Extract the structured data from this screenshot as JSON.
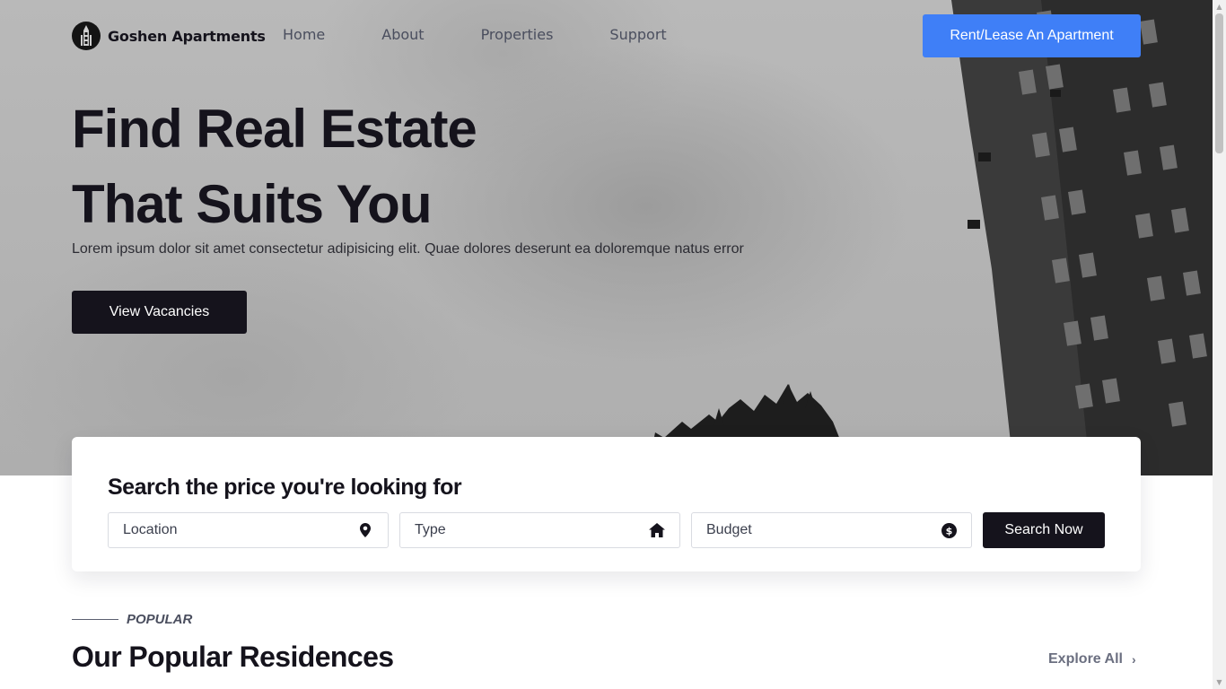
{
  "nav": {
    "brand_name": "Goshen Apartments",
    "links": [
      "Home",
      "About",
      "Properties",
      "Support"
    ],
    "cta_label": "Rent/Lease An Apartment",
    "cta_color": "#3f7ff7"
  },
  "hero": {
    "title_line1": "Find Real Estate",
    "title_line2": "That Suits You",
    "subtitle": "Lorem ipsum dolor sit amet consectetur adipisicing elit. Quae dolores deserunt ea doloremque natus error",
    "button_label": "View Vacancies"
  },
  "search": {
    "title": "Search the price you're looking for",
    "fields": [
      {
        "label": "Location",
        "icon": "map-pin-icon"
      },
      {
        "label": "Type",
        "icon": "home-icon"
      },
      {
        "label": "Budget",
        "icon": "dollar-circle-icon"
      }
    ],
    "button_label": "Search Now"
  },
  "popular": {
    "eyebrow": "POPULAR",
    "title": "Our Popular Residences",
    "explore_label": "Explore All",
    "explore_icon": "chevron-right-icon"
  },
  "colors": {
    "dark": "#15131c",
    "accent": "#3f7ff7"
  }
}
